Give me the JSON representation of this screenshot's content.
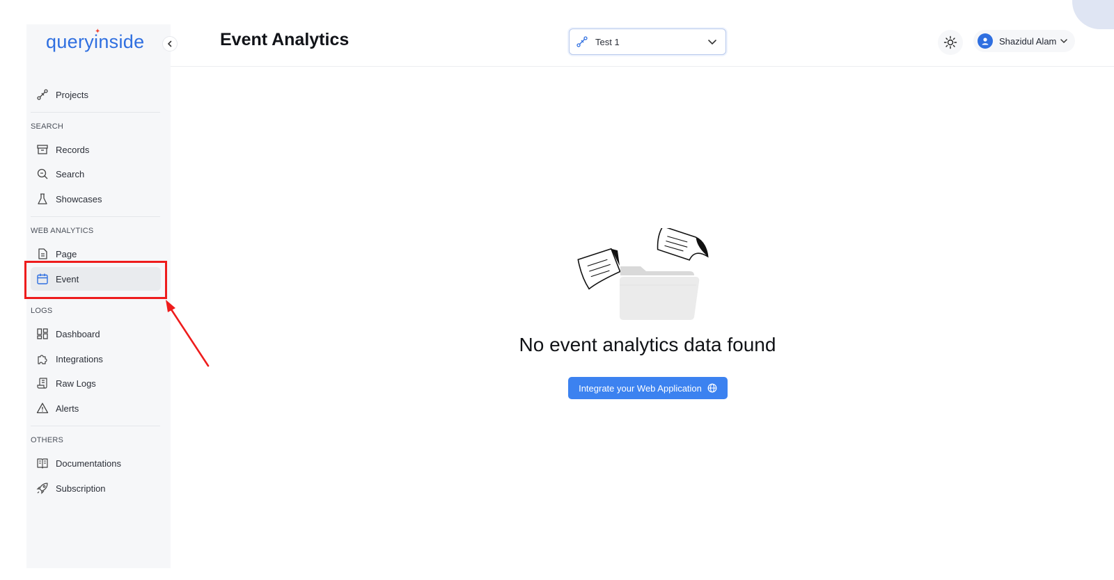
{
  "app": {
    "logo_text": "queryinside"
  },
  "sidebar": {
    "top_item": {
      "label": "Projects",
      "icon": "projects-icon"
    },
    "sections": [
      {
        "title": "SEARCH",
        "items": [
          {
            "label": "Records",
            "icon": "archive-icon"
          },
          {
            "label": "Search",
            "icon": "search-icon"
          },
          {
            "label": "Showcases",
            "icon": "flask-icon"
          }
        ]
      },
      {
        "title": "WEB ANALYTICS",
        "items": [
          {
            "label": "Page",
            "icon": "document-icon"
          },
          {
            "label": "Event",
            "icon": "calendar-icon",
            "active": true
          }
        ]
      },
      {
        "title": "LOGS",
        "items": [
          {
            "label": "Dashboard",
            "icon": "dashboard-icon"
          },
          {
            "label": "Integrations",
            "icon": "puzzle-icon"
          },
          {
            "label": "Raw Logs",
            "icon": "scroll-icon"
          },
          {
            "label": "Alerts",
            "icon": "alert-triangle-icon"
          }
        ]
      },
      {
        "title": "OTHERS",
        "items": [
          {
            "label": "Documentations",
            "icon": "book-icon"
          },
          {
            "label": "Subscription",
            "icon": "rocket-icon"
          }
        ]
      }
    ]
  },
  "header": {
    "title": "Event Analytics",
    "project_select": {
      "value": "Test 1"
    },
    "user": {
      "name": "Shazidul Alam"
    }
  },
  "empty_state": {
    "message": "No event analytics data found",
    "button_label": "Integrate your Web Application"
  },
  "colors": {
    "accent": "#3c82f0",
    "brand": "#2f6fe0",
    "annotation": "#ee1c1c",
    "sidebar_bg": "#f6f7f9"
  }
}
